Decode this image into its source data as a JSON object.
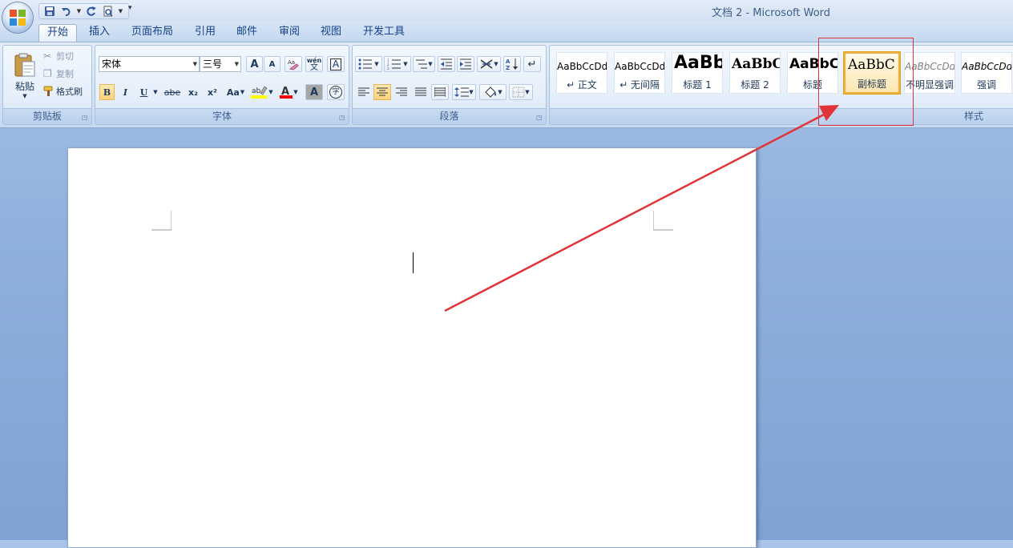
{
  "window": {
    "title": "文档 2 - Microsoft Word"
  },
  "tabs": [
    "开始",
    "插入",
    "页面布局",
    "引用",
    "邮件",
    "审阅",
    "视图",
    "开发工具"
  ],
  "active_tab": "开始",
  "clipboard": {
    "label": "剪贴板",
    "paste": "粘贴",
    "cut": "剪切",
    "copy": "复制",
    "format_painter": "格式刷"
  },
  "font": {
    "label": "字体",
    "font_name": "宋体",
    "font_size": "三号",
    "bold": "B",
    "italic": "I",
    "underline": "U",
    "strike": "abe",
    "subscript": "x₂",
    "superscript": "x²",
    "change_case": "Aa",
    "grow": "A",
    "shrink": "A",
    "pinyin": "wén",
    "phonetic_char": "文",
    "char_border": "A",
    "char_shading": "A",
    "enclose": "字",
    "highlight_label": "ab",
    "font_color_label": "A",
    "highlight_color": "#ffff00",
    "font_color": "#ff0000"
  },
  "paragraph": {
    "label": "段落"
  },
  "styles": {
    "label": "样式",
    "items": [
      {
        "sample": "AaBbCcDd",
        "name": "↵ 正文"
      },
      {
        "sample": "AaBbCcDd",
        "name": "↵ 无间隔"
      },
      {
        "sample": "AaBb",
        "name": "标题 1"
      },
      {
        "sample": "AaBbC",
        "name": "标题 2"
      },
      {
        "sample": "AaBbC",
        "name": "标题"
      },
      {
        "sample": "AaBbC",
        "name": "副标题"
      },
      {
        "sample": "AaBbCcDd",
        "name": "不明显强调"
      },
      {
        "sample": "AaBbCcDd",
        "name": "强调"
      }
    ],
    "selected": "副标题"
  },
  "annotation": {
    "color": "#e0343a"
  }
}
